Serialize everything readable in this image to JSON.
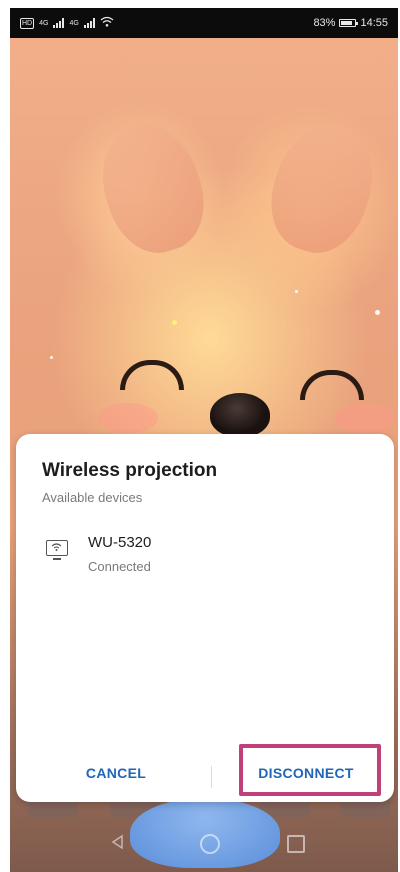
{
  "status_bar": {
    "network_badge": "HD",
    "signal_1": "4G",
    "signal_2": "4G",
    "battery_percent": "83%",
    "battery_level": 0.83,
    "time": "14:55"
  },
  "dialog": {
    "title": "Wireless projection",
    "subtitle": "Available devices",
    "devices": [
      {
        "name": "WU-5320",
        "status": "Connected",
        "icon": "cast-display-icon"
      }
    ],
    "actions": {
      "cancel_label": "CANCEL",
      "disconnect_label": "DISCONNECT"
    }
  },
  "nav_bar": {
    "back_icon": "back-icon",
    "home_icon": "home-icon",
    "recents_icon": "recents-icon"
  },
  "colors": {
    "accent": "#1f66b8",
    "highlight": "#c0407a",
    "status_bar_bg": "#0c0c0c"
  }
}
